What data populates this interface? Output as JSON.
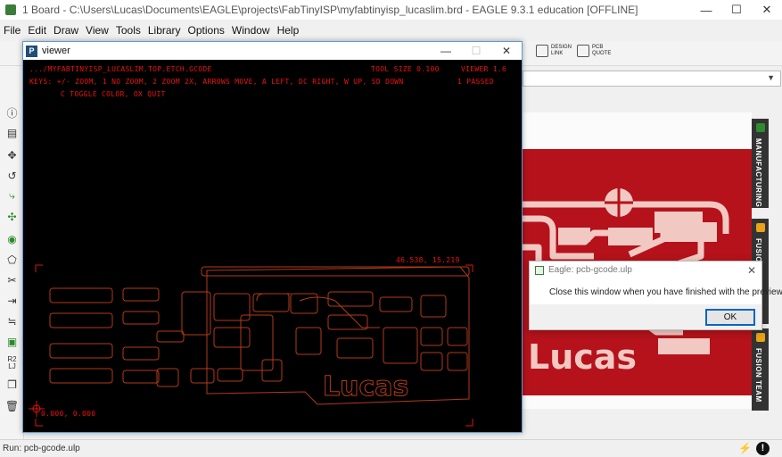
{
  "window": {
    "title": "1 Board - C:\\Users\\Lucas\\Documents\\EAGLE\\projects\\FabTinyISP\\myfabtinyisp_lucaslim.brd - EAGLE 9.3.1 education [OFFLINE]",
    "minimize": "—",
    "maximize": "☐",
    "close": "✕"
  },
  "menu": [
    "File",
    "Edit",
    "Draw",
    "View",
    "Tools",
    "Library",
    "Options",
    "Window",
    "Help"
  ],
  "toolbar": {
    "design_link": [
      "DESIGN",
      "LINK"
    ],
    "pcb_quote": [
      "PCB",
      "QUOTE"
    ]
  },
  "left_tools": [
    "info-icon",
    "layer-icon",
    "move-icon",
    "rotate-icon",
    "route-icon",
    "ripup-icon",
    "via-icon",
    "polygon-icon",
    "split-icon",
    "optimize-icon",
    "align-icon",
    "group-icon",
    "label-icon",
    "copy-icon",
    "delete-icon"
  ],
  "left_tools_text": {
    "r2": "R2",
    "r2_sub": "LJ"
  },
  "side_tabs": [
    {
      "label": "MANUFACTURING",
      "color": "#2e8b2e"
    },
    {
      "label": "FUSION SYNC",
      "color": "#e8a317"
    },
    {
      "label": "FUSION TEAM",
      "color": "#e8a317"
    }
  ],
  "board": {
    "text": "Lucas",
    "board_color": "#b5121b",
    "copper_color": "#f2c9c2"
  },
  "viewer": {
    "title": "viewer",
    "icon_letter": "P",
    "hud": {
      "file": ".../myfabtinyisp_lucaslim.top.etch.gcode",
      "tool_size": "tool size 0.100",
      "version": "viewer 1.6",
      "keys_line1": "keys: +/- zoom, 1 no zoom, 2 zoom 2x, arrows move, a left, dc right, w up, sd down",
      "passes": "1 passed",
      "keys_line2": "c toggle color, ox quit",
      "coord_top": "46.538, 15.219",
      "coord_origin": "0.000, 0.000"
    },
    "trace_color": "#b33a1a",
    "hud_color": "#e11111",
    "artwork_text": "Lucas"
  },
  "dialog": {
    "title": "Eagle: pcb-gcode.ulp",
    "message": "Close this window when you have finished with the preview",
    "ok": "OK"
  },
  "status": {
    "text": "Run: pcb-gcode.ulp",
    "warn": "!"
  }
}
